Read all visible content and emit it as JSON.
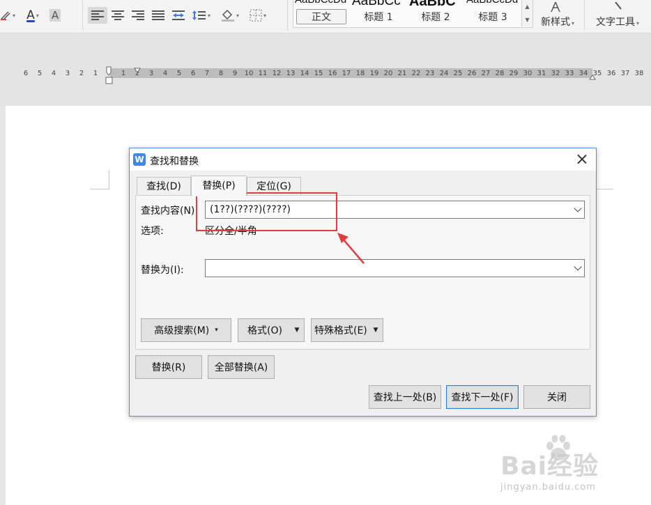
{
  "toolbar": {
    "font_color_glyph": "A",
    "char_shade_glyph": "A",
    "styles": [
      {
        "preview": "AaBbCcDd",
        "label": "正文"
      },
      {
        "preview": "AaBbCc",
        "label": "标题 1"
      },
      {
        "preview": "AaBbC",
        "label": "标题 2"
      },
      {
        "preview": "AaBbCcDd",
        "label": "标题 3"
      }
    ],
    "new_style_label": "新样式",
    "text_tools_label": "文字工具"
  },
  "ruler": {
    "left_numbers": [
      "6",
      "5",
      "4",
      "3",
      "2",
      "1"
    ],
    "right_numbers": [
      "1",
      "2",
      "3",
      "4",
      "5",
      "6",
      "7",
      "8",
      "9",
      "10",
      "11",
      "12",
      "13",
      "14",
      "15",
      "16",
      "17",
      "18",
      "19",
      "20",
      "21",
      "22",
      "23",
      "24",
      "25",
      "26",
      "27",
      "28",
      "29",
      "30",
      "31",
      "32",
      "33",
      "34",
      "35",
      "36",
      "37",
      "38"
    ]
  },
  "dialog": {
    "title": "查找和替换",
    "tabs": [
      {
        "label": "查找(D)",
        "active": false
      },
      {
        "label": "替换(P)",
        "active": true
      },
      {
        "label": "定位(G)",
        "active": false
      }
    ],
    "find_label": "查找内容(N):",
    "find_value": "(1??)(????)(????)",
    "options_label": "选项:",
    "options_value": "区分全/半角",
    "replace_label": "替换为(I):",
    "replace_value": "",
    "advanced_search_label": "高级搜索(M)",
    "format_label": "格式(O)",
    "special_format_label": "特殊格式(E)",
    "replace_button": "替换(R)",
    "replace_all_button": "全部替换(A)",
    "find_prev_button": "查找上一处(B)",
    "find_next_button": "查找下一处(F)",
    "close_button": "关闭"
  },
  "annotation": {
    "highlight_color": "#e23b3b"
  },
  "watermark": {
    "text": "Bai经验",
    "url": "jingyan.baidu.com"
  }
}
